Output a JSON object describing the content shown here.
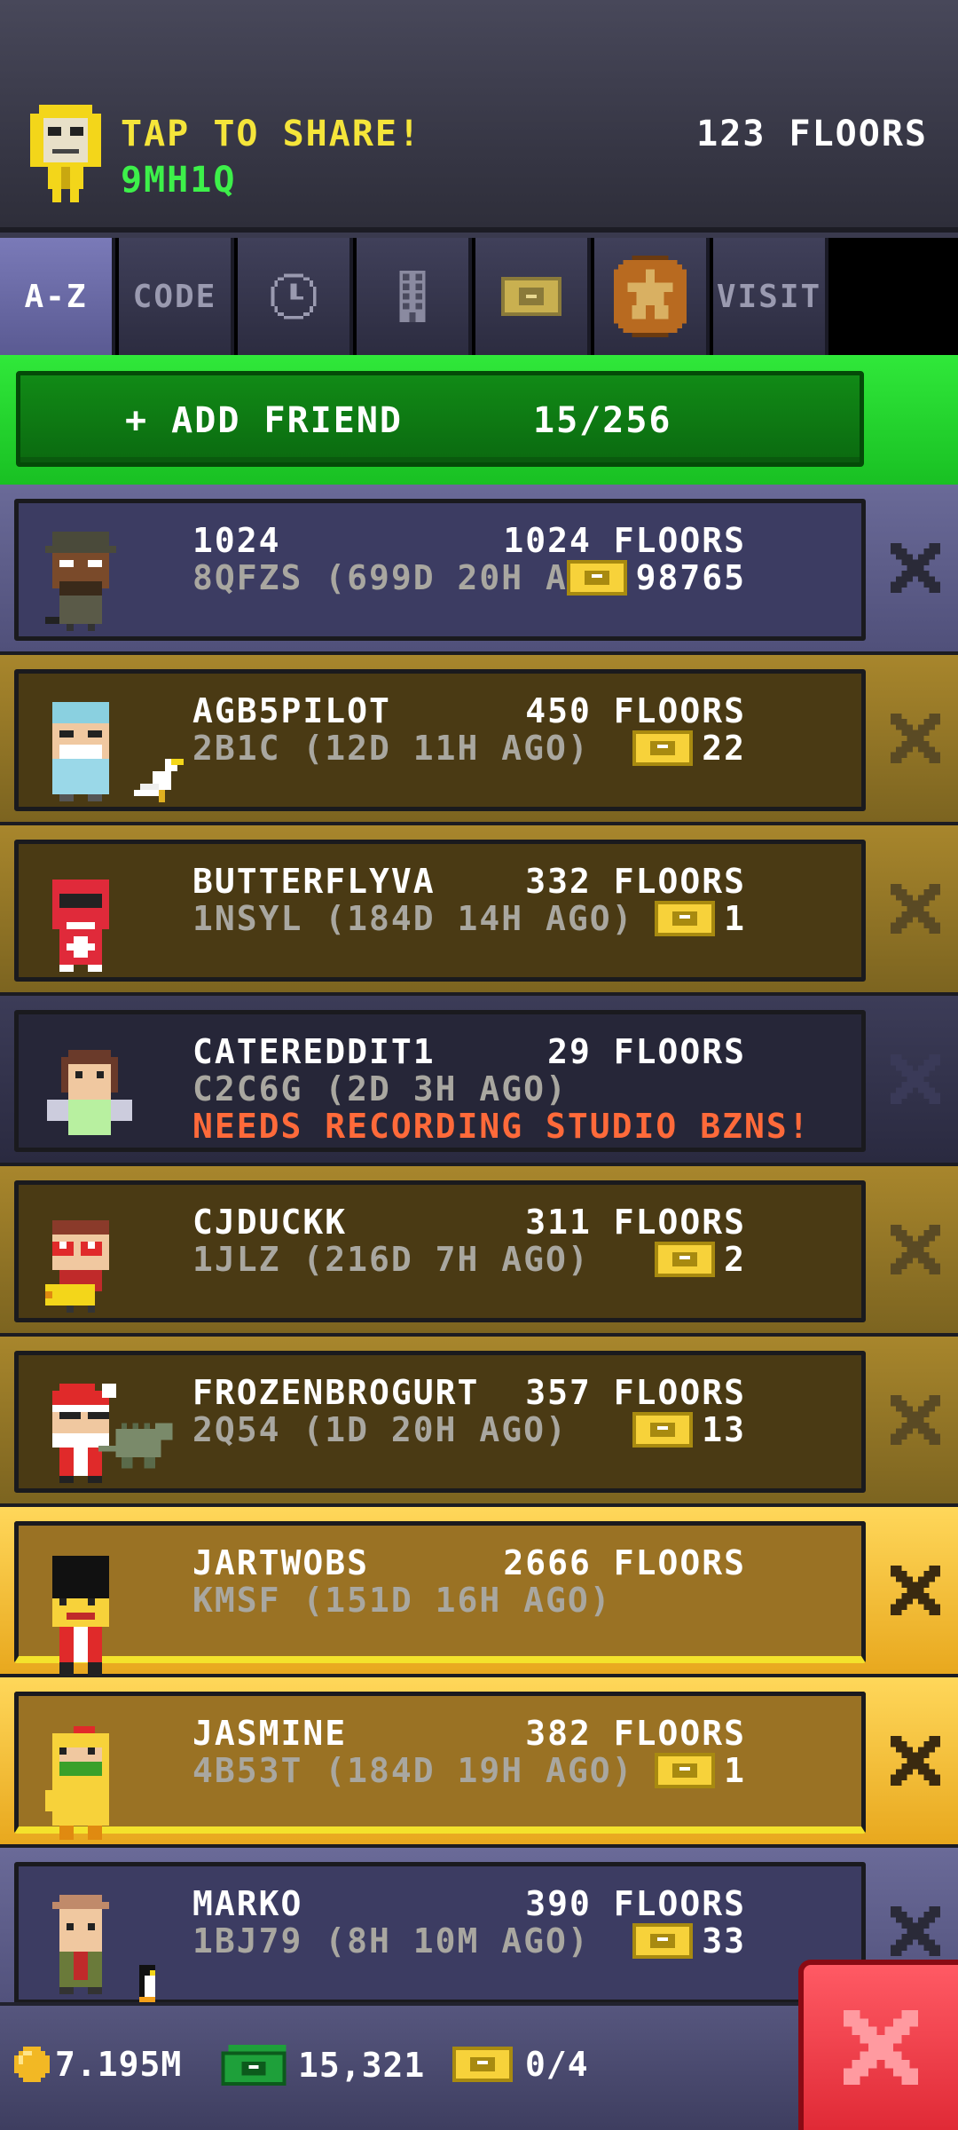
{
  "header": {
    "share_label": "TAP TO SHARE!",
    "share_code": "9MH1Q",
    "floors": "123 FLOORS"
  },
  "tabs": [
    {
      "label": "A-Z",
      "icon": null,
      "active": true
    },
    {
      "label": "CODE",
      "icon": null,
      "active": false
    },
    {
      "label": "",
      "icon": "clock-icon",
      "active": false
    },
    {
      "label": "",
      "icon": "building-icon",
      "active": false
    },
    {
      "label": "",
      "icon": "bux-icon",
      "active": false
    },
    {
      "label": "",
      "icon": "star-medal-icon",
      "active": false
    },
    {
      "label": "VISIT",
      "icon": null,
      "active": false
    }
  ],
  "add_friend": {
    "label": "+ ADD FRIEND",
    "count": "15/256"
  },
  "friends": [
    {
      "name": "1024",
      "floors": "1024 FLOORS",
      "code": "8QFZS (699D 20H AGO)",
      "bux": "98765",
      "message": "",
      "style": "blue"
    },
    {
      "name": "AGB5PILOT",
      "floors": "450 FLOORS",
      "code": "2B1C (12D 11H AGO)",
      "bux": "22",
      "message": "",
      "style": "brown"
    },
    {
      "name": "BUTTERFLYVA",
      "floors": "332 FLOORS",
      "code": "1NSYL (184D 14H AGO)",
      "bux": "1",
      "message": "",
      "style": "brown"
    },
    {
      "name": "CATEREDDIT1",
      "floors": "29 FLOORS",
      "code": "C2C6G (2D 3H AGO)",
      "bux": "",
      "message": "NEEDS RECORDING STUDIO BZNS!",
      "style": "dark"
    },
    {
      "name": "CJDUCKK",
      "floors": "311 FLOORS",
      "code": "1JLZ (216D 7H AGO)",
      "bux": "2",
      "message": "",
      "style": "brown"
    },
    {
      "name": "FROZENBROGURT",
      "floors": "357 FLOORS",
      "code": "2Q54 (1D 20H AGO)",
      "bux": "13",
      "message": "",
      "style": "brown"
    },
    {
      "name": "JARTWOBS",
      "floors": "2666 FLOORS",
      "code": "KMSF (151D 16H AGO)",
      "bux": "",
      "message": "",
      "style": "gold"
    },
    {
      "name": "JASMINE",
      "floors": "382 FLOORS",
      "code": "4B53T (184D 19H AGO)",
      "bux": "1",
      "message": "",
      "style": "gold"
    },
    {
      "name": "MARKO",
      "floors": "390 FLOORS",
      "code": "1BJ79 (8H 10M AGO)",
      "bux": "33",
      "message": "",
      "style": "blue"
    }
  ],
  "bottom": {
    "coins": "7.195M",
    "bux": "15,321",
    "vip": "0/4"
  },
  "colors": {
    "share_yellow": "#f5e53a",
    "code_green": "#3df04a",
    "message_orange": "#ff6a3a",
    "add_bar_green": "#19c023",
    "close_red": "#e02a36"
  }
}
